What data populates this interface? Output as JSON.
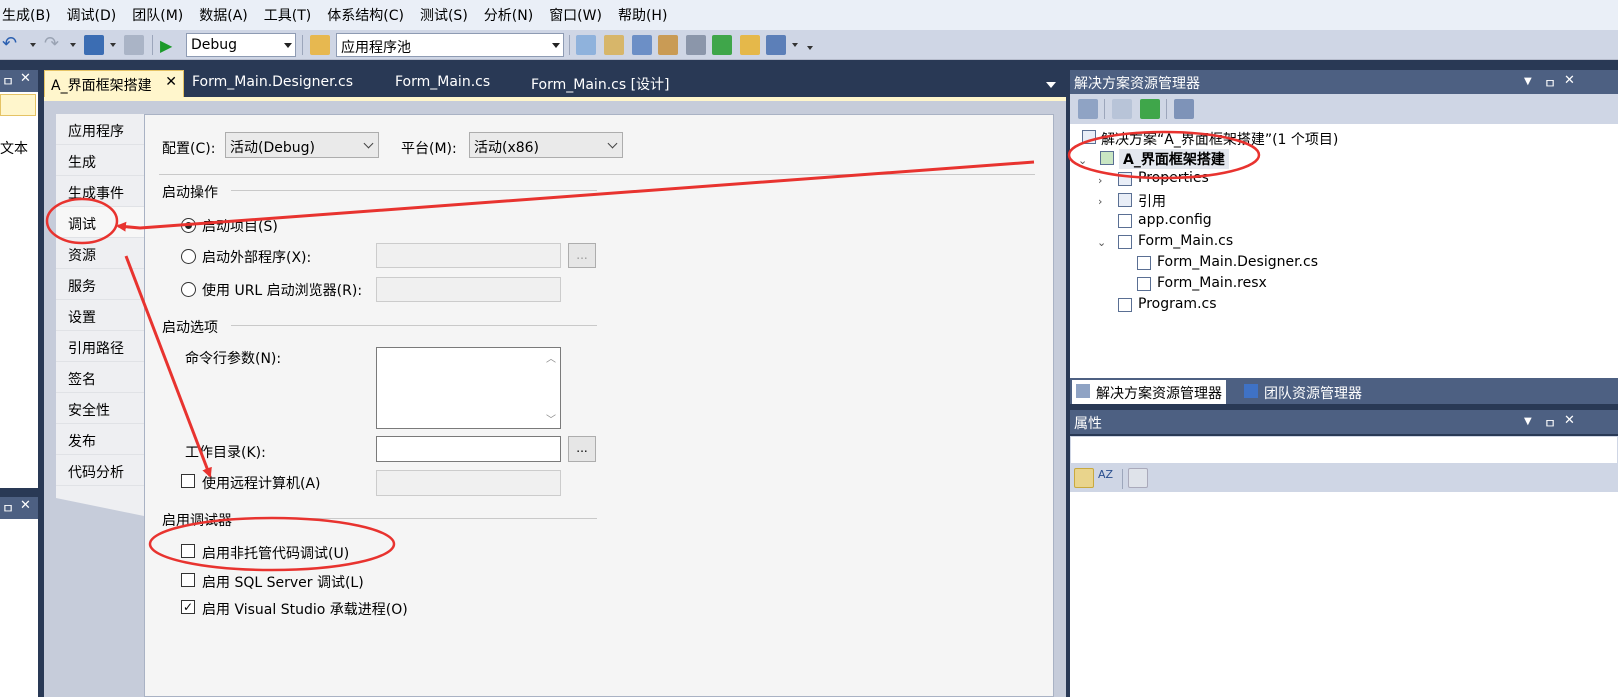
{
  "menu": [
    "生成(B)",
    "调试(D)",
    "团队(M)",
    "数据(A)",
    "工具(T)",
    "体系结构(C)",
    "测试(S)",
    "分析(N)",
    "窗口(W)",
    "帮助(H)"
  ],
  "toolbar": {
    "config_value": "Debug",
    "target_value": "应用程序池"
  },
  "left_panel": {
    "text_fragment": "文本"
  },
  "doc_tabs": [
    {
      "label": "A_界面框架搭建",
      "active": true
    },
    {
      "label": "Form_Main.Designer.cs",
      "active": false
    },
    {
      "label": "Form_Main.cs",
      "active": false
    },
    {
      "label": "Form_Main.cs [设计]",
      "active": false
    }
  ],
  "nav": [
    "应用程序",
    "生成",
    "生成事件",
    "调试",
    "资源",
    "服务",
    "设置",
    "引用路径",
    "签名",
    "安全性",
    "发布",
    "代码分析"
  ],
  "nav_active": "调试",
  "config": {
    "config_label": "配置(C):",
    "config_value": "活动(Debug)",
    "platform_label": "平台(M):",
    "platform_value": "活动(x86)"
  },
  "start_action": {
    "title": "启动操作",
    "start_project": "启动项目(S)",
    "start_external": "启动外部程序(X):",
    "start_url": "使用 URL 启动浏览器(R):",
    "browse": "..."
  },
  "start_options": {
    "title": "启动选项",
    "cmd_args": "命令行参数(N):",
    "work_dir": "工作目录(K):",
    "remote": "使用远程计算机(A)",
    "browse": "..."
  },
  "debuggers": {
    "title": "启用调试器",
    "native": "启用非托管代码调试(U)",
    "sql": "启用 SQL Server 调试(L)",
    "vshost": "启用 Visual Studio 承载进程(O)"
  },
  "solution_explorer": {
    "title": "解决方案资源管理器",
    "solution": "解决方案“A_界面框架搭建”(1 个项目)",
    "project": "A_界面框架搭建",
    "items": [
      "Properties",
      "引用",
      "app.config",
      "Form_Main.cs",
      "Form_Main.Designer.cs",
      "Form_Main.resx",
      "Program.cs"
    ]
  },
  "bottom_tabs": [
    "解决方案资源管理器",
    "团队资源管理器"
  ],
  "properties": {
    "title": "属性"
  },
  "pane_controls": {
    "pin": "ㅁ",
    "close": "✕",
    "dropdown": "▼"
  },
  "colors": {
    "annotation": "#e8332f",
    "chrome": "#293955",
    "header": "#4d6082",
    "tab_active": "#fff6cc"
  }
}
